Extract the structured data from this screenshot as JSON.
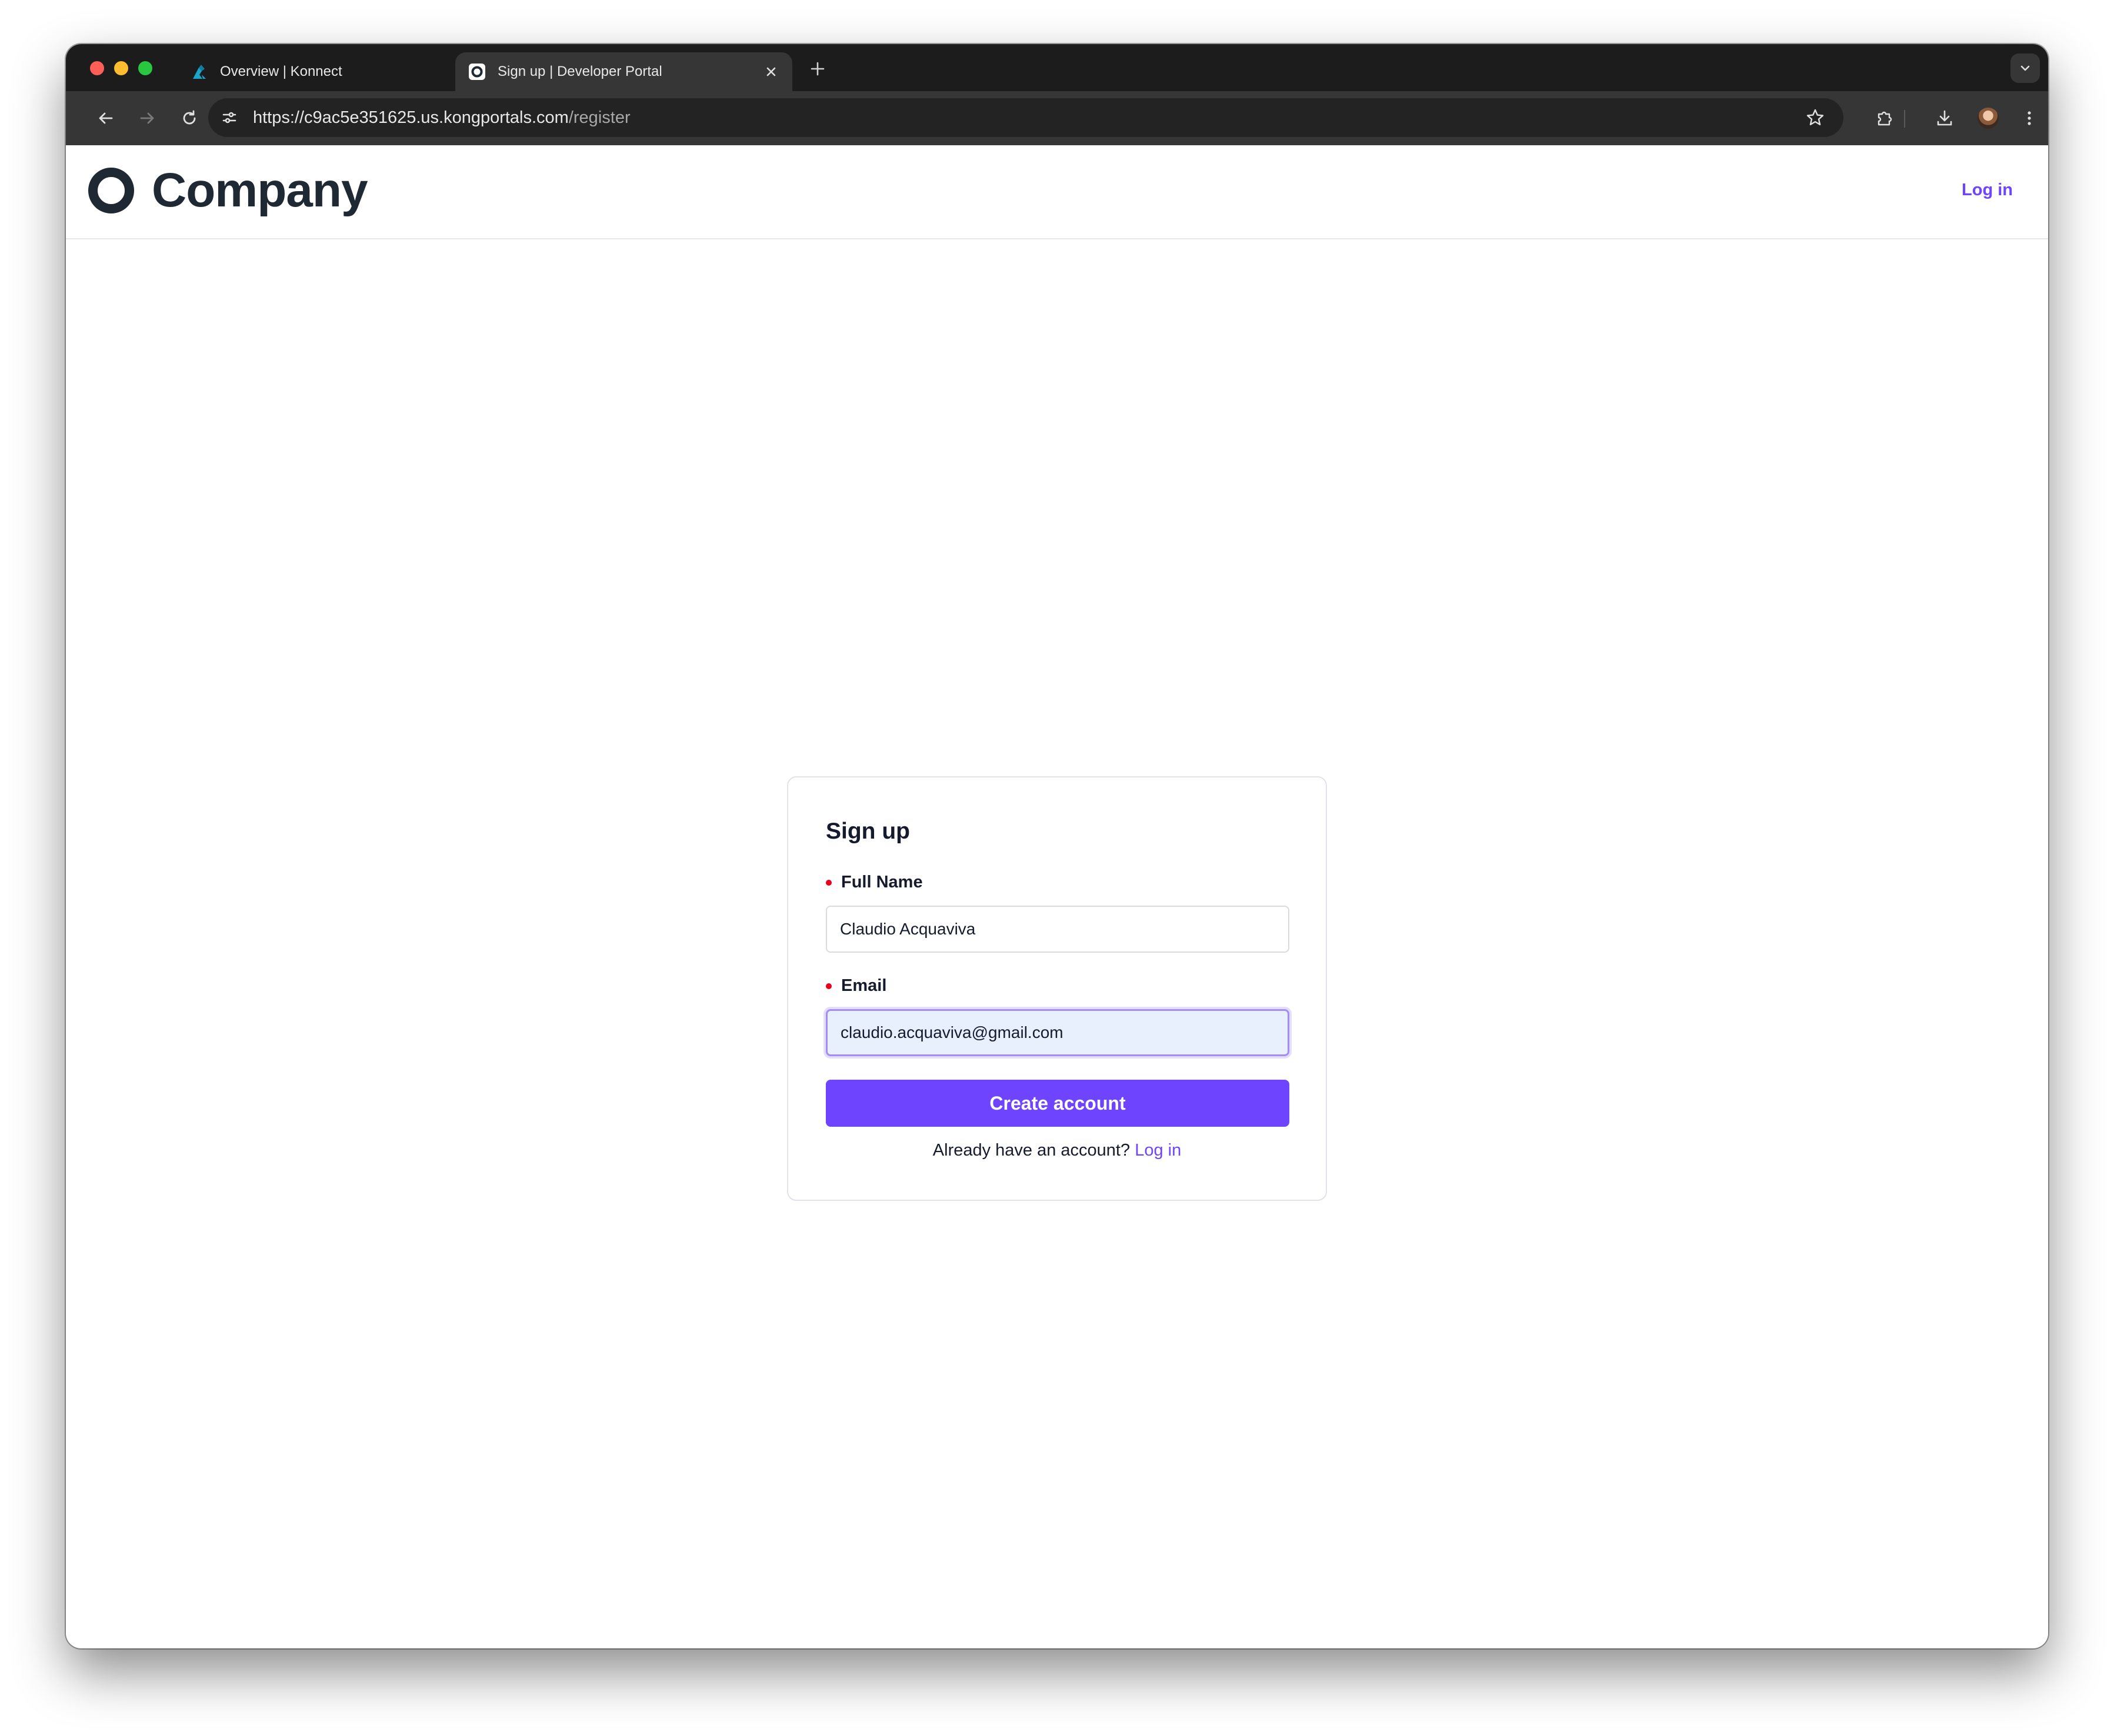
{
  "browser": {
    "tabs": [
      {
        "title": "Overview | Konnect",
        "active": false,
        "icon": "konnect-logo-icon"
      },
      {
        "title": "Sign up | Developer Portal",
        "active": true,
        "icon": "portal-logo-icon"
      }
    ],
    "address_bar": {
      "url_host": "https://c9ac5e351625.us.kongportals.com",
      "url_path": "/register"
    }
  },
  "site": {
    "brand": "Company",
    "header_login": "Log in"
  },
  "signup": {
    "title": "Sign up",
    "full_name": {
      "label": "Full Name",
      "value": "Claudio Acquaviva"
    },
    "email": {
      "label": "Email",
      "value": "claudio.acquaviva@gmail.com"
    },
    "submit_label": "Create account",
    "login_prompt": "Already have an account?",
    "login_link": "Log in"
  },
  "colors": {
    "accent": "#6e44ff",
    "required": "#e8001c",
    "text": "#151a2d"
  }
}
